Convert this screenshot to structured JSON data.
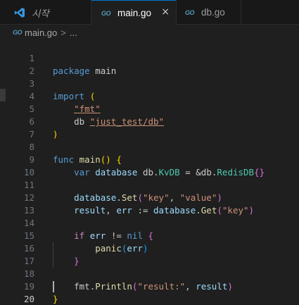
{
  "tabs": [
    {
      "label": "시작",
      "icon": "vscode-icon"
    },
    {
      "label": "main.go",
      "icon": "go-file-icon",
      "active": true,
      "close": "×"
    },
    {
      "label": "db.go",
      "icon": "go-file-icon"
    }
  ],
  "go_icon_text": "GO",
  "breadcrumb": {
    "file": "main.go",
    "sep": ">",
    "more": "..."
  },
  "editor": {
    "active_line": 20,
    "lines": [
      {
        "n": "1"
      },
      {
        "n": "2"
      },
      {
        "n": "3"
      },
      {
        "n": "4"
      },
      {
        "n": "5"
      },
      {
        "n": "6"
      },
      {
        "n": "7"
      },
      {
        "n": "8"
      },
      {
        "n": "9"
      },
      {
        "n": "10"
      },
      {
        "n": "11"
      },
      {
        "n": "12"
      },
      {
        "n": "13"
      },
      {
        "n": "14"
      },
      {
        "n": "15"
      },
      {
        "n": "16"
      },
      {
        "n": "17"
      },
      {
        "n": "18"
      },
      {
        "n": "19"
      },
      {
        "n": "20"
      }
    ],
    "tokens": {
      "package": "package",
      "main": "main",
      "import": "import",
      "open_paren": "(",
      "close_paren": ")",
      "fmt_str": "\"fmt\"",
      "db_alias": "db",
      "db_str": "\"just_test/db\"",
      "func": "func",
      "main_fn": "main",
      "fn_parens": "()",
      "brace_open": "{",
      "brace_close": "}",
      "var": "var",
      "database": "database",
      "dbpkg": "db",
      "kvdb": "KvDB",
      "eq": "=",
      "amp": "&",
      "redisdb": "RedisDB",
      "empty_braces": "{}",
      "set": "Set",
      "key_str": "\"key\"",
      "value_str": "\"value\"",
      "comma": ",",
      "result": "result",
      "err": "err",
      "assign": ":=",
      "get": "Get",
      "if": "if",
      "neq": "!=",
      "nil": "nil",
      "panic": "panic",
      "fmt": "fmt",
      "println": "Println",
      "result_str": "\"result:\""
    }
  },
  "colors": {
    "keyword": "#569cd6",
    "control": "#c586c0",
    "string": "#ce9178",
    "function": "#dcdcaa",
    "variable": "#9cdcfe",
    "type": "#4ec9b0",
    "bracket1": "#ffd700",
    "bracket2": "#da70d6",
    "bracket3": "#179fff",
    "accent": "#0078d4"
  }
}
